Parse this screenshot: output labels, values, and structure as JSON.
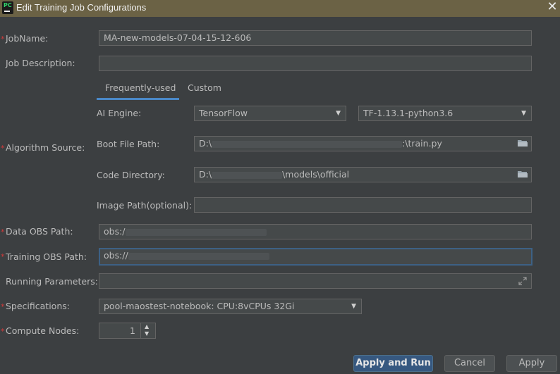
{
  "window": {
    "title": "Edit Training Job Configurations",
    "app_icon": "pycharm-icon",
    "close_icon": "close-icon"
  },
  "fields": {
    "job_name": {
      "label": "JobName:",
      "value": "MA-new-models-07-04-15-12-606",
      "required": true
    },
    "job_description": {
      "label": "Job Description:",
      "value": ""
    },
    "algorithm_source": {
      "label": "Algorithm Source:",
      "required": true
    },
    "data_obs_path": {
      "label": "Data OBS Path:",
      "value": "obs:/",
      "required": true
    },
    "training_obs_path": {
      "label": "Training OBS Path:",
      "value": "obs://",
      "required": true
    },
    "running_parameters": {
      "label": "Running Parameters:",
      "value": ""
    },
    "specifications": {
      "label": "Specifications:",
      "value": "pool-maostest-notebook: CPU:8vCPUs 32Gi",
      "required": true
    },
    "compute_nodes": {
      "label": "Compute Nodes:",
      "value": "1",
      "required": true
    }
  },
  "tabs": [
    {
      "label": "Frequently-used",
      "selected": true
    },
    {
      "label": "Custom",
      "selected": false
    }
  ],
  "algorithm": {
    "ai_engine_label": "AI Engine:",
    "engine": "TensorFlow",
    "engine_version": "TF-1.13.1-python3.6",
    "boot_file_label": "Boot File Path:",
    "boot_file_prefix": "D:\\",
    "boot_file_suffix": ":\\train.py",
    "code_dir_label": "Code Directory:",
    "code_dir_prefix": "D:\\",
    "code_dir_suffix": "\\models\\official",
    "image_path_label": "Image Path(optional):",
    "image_path": ""
  },
  "required_mark": "*",
  "buttons": {
    "apply_and_run": "Apply and Run",
    "cancel": "Cancel",
    "apply": "Apply"
  },
  "colors": {
    "background": "#3c3f41",
    "titlebar": "#6b6245",
    "primary_button": "#365880",
    "required": "#d13b3b",
    "tab_underline": "#4a88c7"
  }
}
